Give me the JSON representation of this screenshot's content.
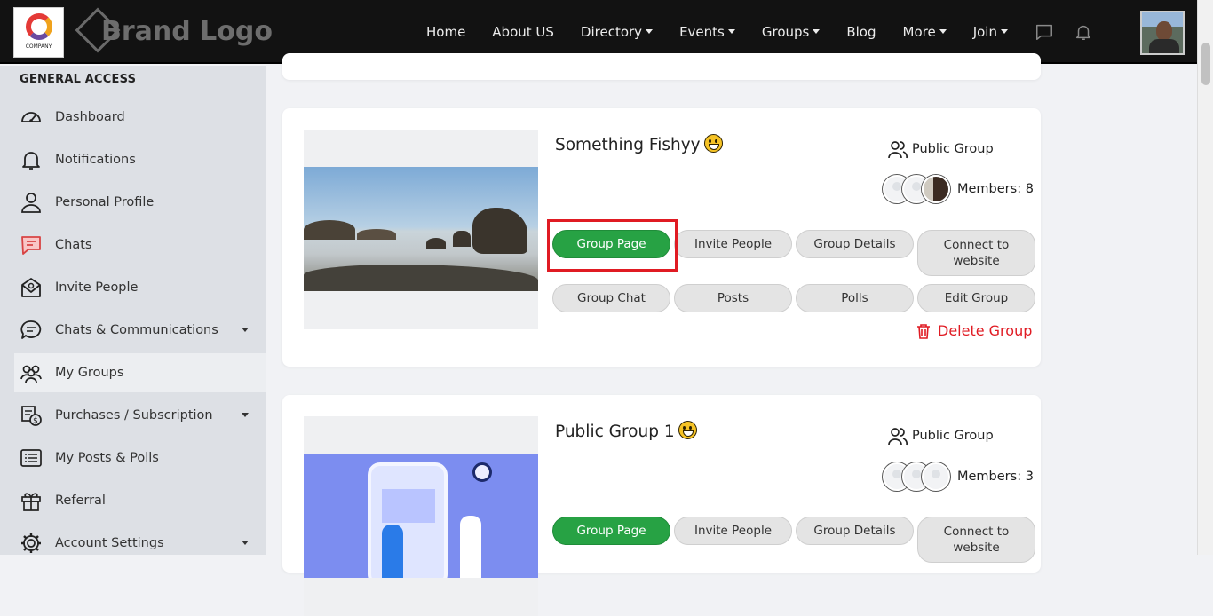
{
  "header": {
    "logo_caption": "COMPANY",
    "brand_text": "Brand Logo",
    "nav": [
      "Home",
      "About US",
      "Directory",
      "Events",
      "Groups",
      "Blog",
      "More",
      "Join"
    ]
  },
  "sidebar": {
    "heading": "GENERAL ACCESS",
    "items": [
      {
        "label": "Dashboard"
      },
      {
        "label": "Notifications"
      },
      {
        "label": "Personal Profile"
      },
      {
        "label": "Chats"
      },
      {
        "label": "Invite People"
      },
      {
        "label": "Chats & Communications"
      },
      {
        "label": "My Groups"
      },
      {
        "label": "Purchases / Subscription"
      },
      {
        "label": "My Posts & Polls"
      },
      {
        "label": "Referral"
      },
      {
        "label": "Account Settings"
      }
    ]
  },
  "groups": [
    {
      "name": "Something Fishyy",
      "type": "Public Group",
      "members": "Members: 8",
      "buttons": [
        "Group Page",
        "Invite People",
        "Group Details",
        "Connect to website",
        "Group Chat",
        "Posts",
        "Polls",
        "Edit Group"
      ],
      "delete": "Delete Group"
    },
    {
      "name": "Public Group 1",
      "type": "Public Group",
      "members": "Members: 3",
      "buttons": [
        "Group Page",
        "Invite People",
        "Group Details",
        "Connect to website"
      ]
    }
  ],
  "colors": {
    "primary_button": "#27a244",
    "danger": "#e01b23",
    "topbar": "#121212",
    "sidebar": "#dde0e5"
  }
}
